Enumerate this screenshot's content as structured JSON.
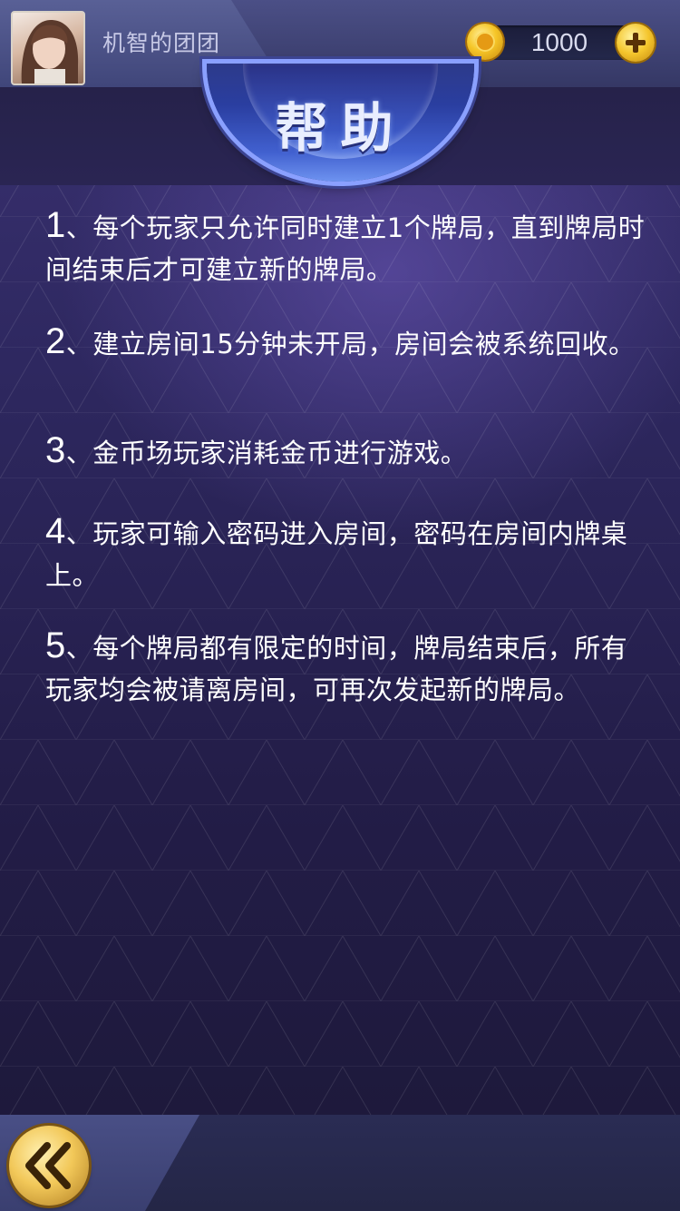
{
  "user": {
    "name": "机智的团团",
    "avatar_icon": "avatar-portrait"
  },
  "wallet": {
    "coins": "1000",
    "coin_icon": "gold-coin-icon",
    "add_icon": "plus-icon"
  },
  "title": "帮助",
  "rules": [
    {
      "num": "1",
      "text": "、每个玩家只允许同时建立1个牌局，直到牌局时间结束后才可建立新的牌局。"
    },
    {
      "num": "2",
      "text": "、建立房间15分钟未开局，房间会被系统回收。"
    },
    {
      "num": "3",
      "text": "、金币场玩家消耗金币进行游戏。"
    },
    {
      "num": "4",
      "text": "、玩家可输入密码进入房间，密码在房间内牌桌上。"
    },
    {
      "num": "5",
      "text": "、每个牌局都有限定的时间，牌局结束后，所有玩家均会被请离房间，可再次发起新的牌局。"
    }
  ],
  "footer": {
    "back_icon": "double-chevron-left-icon"
  },
  "colors": {
    "accent_gold": "#f2c859",
    "title_blue": "#3b57c4",
    "background": "#2e2860",
    "text": "#ffffff"
  }
}
